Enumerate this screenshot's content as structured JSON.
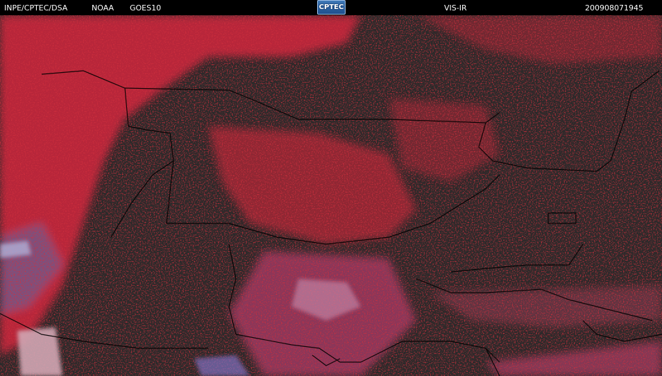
{
  "header": {
    "agency": "INPE/CPTEC/DSA",
    "source": "NOAA",
    "satellite": "GOES10",
    "logo_text": "CPTEC",
    "channel": "VIS-IR",
    "timestamp": "200908071945"
  },
  "colors": {
    "background": "#000000",
    "land": "#2a2a2a",
    "cloud_warm": "#c8283c",
    "cloud_pink": "#b0406e",
    "cloud_blue": "#6a6aa8",
    "cloud_pale": "#d2a6b4",
    "boundary": "#000000"
  }
}
